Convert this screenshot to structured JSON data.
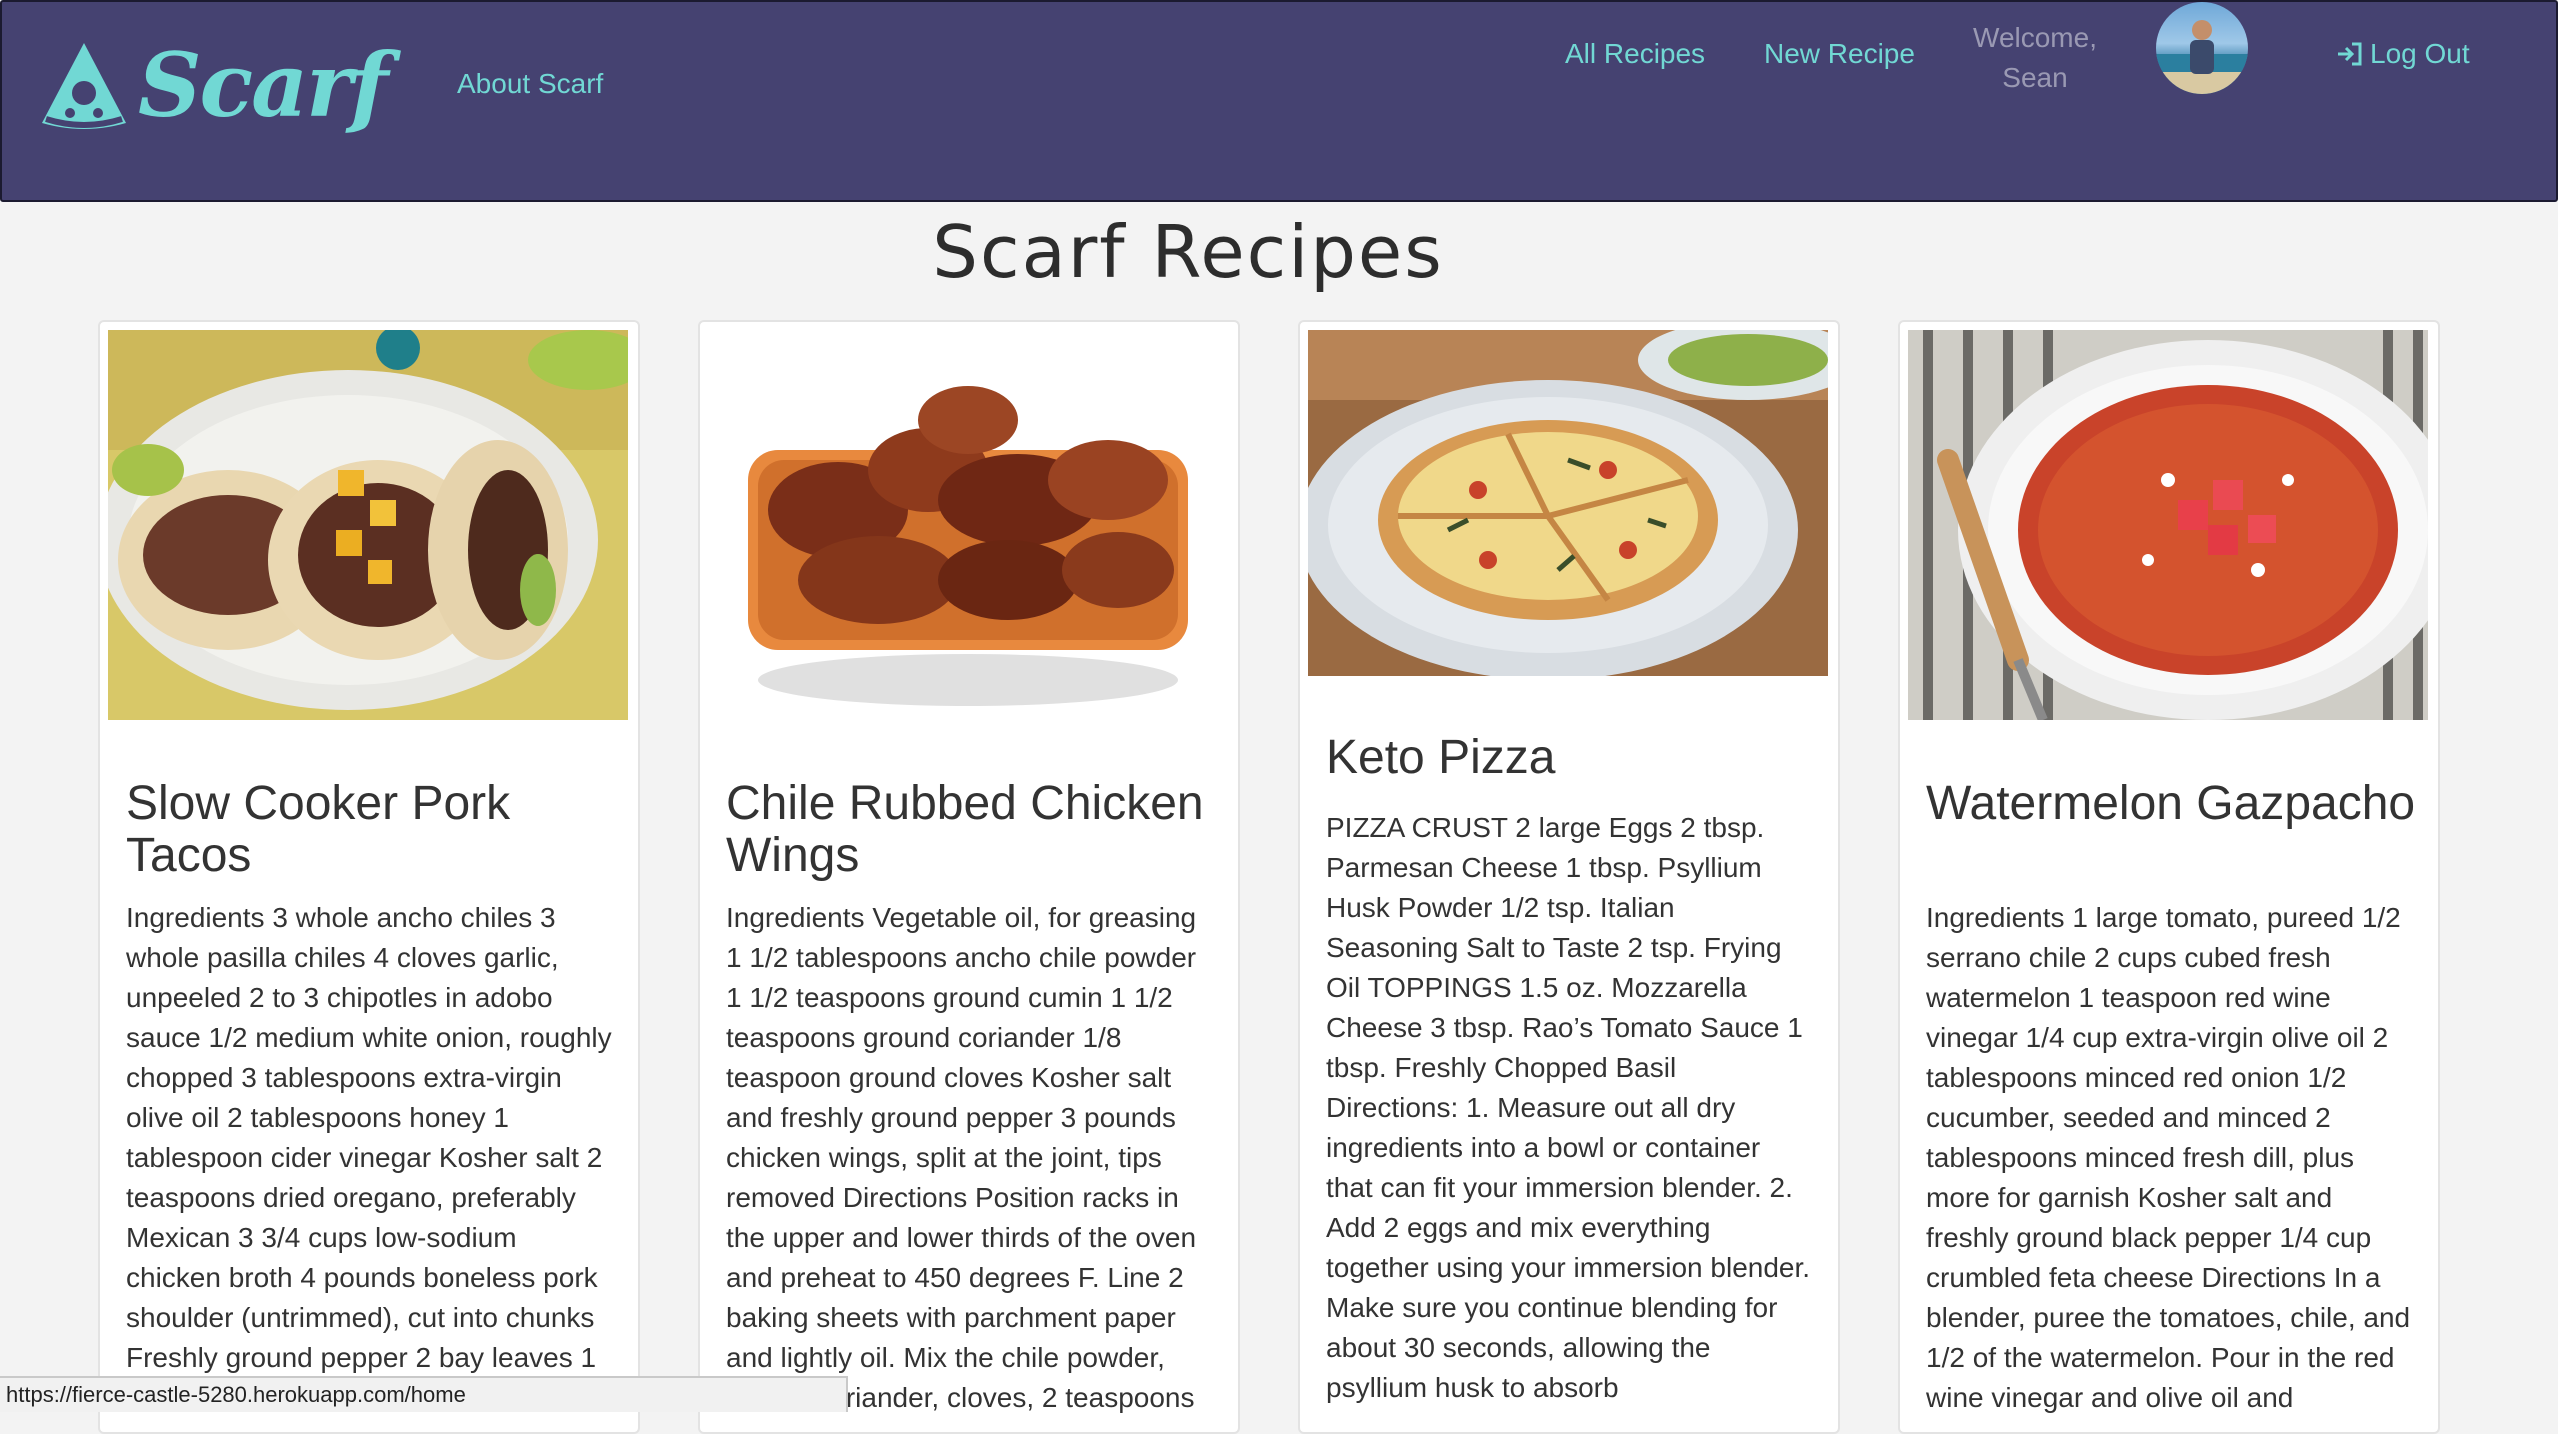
{
  "nav": {
    "brand": "Scarf",
    "about": "About Scarf",
    "all_recipes": "All Recipes",
    "new_recipe": "New Recipe",
    "welcome": "Welcome, Sean",
    "logout": "Log Out"
  },
  "page_title": "Scarf Recipes",
  "recipes": [
    {
      "title": "Slow Cooker Pork Tacos",
      "body": "Ingredients 3 whole ancho chiles 3 whole pasilla chiles 4 cloves garlic, unpeeled 2 to 3 chipotles in adobo sauce 1/2 medium white onion, roughly chopped 3 tablespoons extra-virgin olive oil 2 tablespoons honey 1 tablespoon cider vinegar Kosher salt 2 teaspoons dried oregano, preferably Mexican 3 3/4 cups low-sodium chicken broth 4 pounds boneless pork shoulder (untrimmed), cut into chunks Freshly ground pepper 2 bay leaves 1"
    },
    {
      "title": "Chile Rubbed Chicken Wings",
      "body": "Ingredients Vegetable oil, for greasing 1 1/2 tablespoons ancho chile powder 1 1/2 teaspoons ground cumin 1 1/2 teaspoons ground coriander 1/8 teaspoon ground cloves Kosher salt and freshly ground pepper 3 pounds chicken wings, split at the joint, tips removed Directions Position racks in the upper and lower thirds of the oven and preheat to 450 degrees F. Line 2 baking sheets with parchment paper and lightly oil. Mix the chile powder, cumin, coriander, cloves, 2 teaspoons"
    },
    {
      "title": "Keto Pizza",
      "body": "PIZZA CRUST 2 large Eggs 2 tbsp. Parmesan Cheese 1 tbsp. Psyllium Husk Powder 1/2 tsp. Italian Seasoning Salt to Taste 2 tsp. Frying Oil TOPPINGS 1.5 oz. Mozzarella Cheese 3 tbsp. Rao’s Tomato Sauce 1 tbsp. Freshly Chopped Basil Directions: 1. Measure out all dry ingredients into a bowl or container that can fit your immersion blender. 2. Add 2 eggs and mix everything together using your immersion blender. Make sure you continue blending for about 30 seconds, allowing the psyllium husk to absorb"
    },
    {
      "title": "Watermelon Gazpacho",
      "body": "Ingredients 1 large tomato, pureed 1/2 serrano chile 2 cups cubed fresh watermelon 1 teaspoon red wine vinegar 1/4 cup extra-virgin olive oil 2 tablespoons minced red onion 1/2 cucumber, seeded and minced 2 tablespoons minced fresh dill, plus more for garnish Kosher salt and freshly ground black pepper 1/4 cup crumbled feta cheese Directions In a blender, puree the tomatoes, chile, and 1/2 of the watermelon. Pour in the red wine vinegar and olive oil and"
    }
  ],
  "status_url": "https://fierce-castle-5280.herokuapp.com/home",
  "colors": {
    "navbar": "#454271",
    "accent": "#71d8d4",
    "background": "#f3f3f3"
  }
}
